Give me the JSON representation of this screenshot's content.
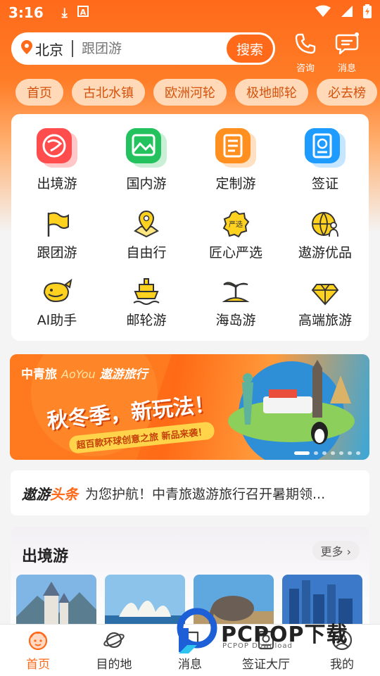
{
  "status_bar": {
    "time": "3:16",
    "icons": [
      "download-icon",
      "font-icon",
      "wifi-icon",
      "signal-icon",
      "battery-icon"
    ]
  },
  "header": {
    "city": "北京",
    "search_placeholder": "跟团游",
    "search_button": "搜索",
    "consult_label": "咨询",
    "message_label": "消息"
  },
  "tags": [
    "首页",
    "古北水镇",
    "欧洲河轮",
    "极地邮轮",
    "必去榜"
  ],
  "categories": [
    {
      "label": "出境游",
      "icon": "globe-plane-icon"
    },
    {
      "label": "国内游",
      "icon": "landscape-photo-icon"
    },
    {
      "label": "定制游",
      "icon": "checklist-icon"
    },
    {
      "label": "签证",
      "icon": "passport-icon"
    },
    {
      "label": "跟团游",
      "icon": "flag-icon"
    },
    {
      "label": "自由行",
      "icon": "map-pin-icon"
    },
    {
      "label": "匠心严选",
      "icon": "quality-seal-icon"
    },
    {
      "label": "遨游优品",
      "icon": "globe-person-icon"
    },
    {
      "label": "AI助手",
      "icon": "whale-icon"
    },
    {
      "label": "邮轮游",
      "icon": "cruise-ship-icon"
    },
    {
      "label": "海岛游",
      "icon": "palm-island-icon"
    },
    {
      "label": "高端旅游",
      "icon": "diamond-icon"
    }
  ],
  "banner": {
    "brand": "中青旅",
    "brand_en": "AoYou",
    "brand_name": "遨游旅行",
    "headline": "秋冬季，新玩法！",
    "subline": "超百款环球创意之旅 新品来袭！",
    "page_count": 7,
    "current_page": 1
  },
  "news": {
    "brand_part1": "遨游",
    "brand_part2": "头条",
    "text": "为您护航！中青旅遨游旅行召开暑期领..."
  },
  "section": {
    "title": "出境游",
    "more_label": "更多 ›"
  },
  "tabbar": [
    {
      "label": "首页",
      "icon": "home-face-icon",
      "active": true
    },
    {
      "label": "目的地",
      "icon": "planet-icon",
      "active": false
    },
    {
      "label": "消息",
      "icon": "message-icon",
      "active": false
    },
    {
      "label": "签证大厅",
      "icon": "visa-icon",
      "active": false
    },
    {
      "label": "我的",
      "icon": "profile-icon",
      "active": false
    }
  ],
  "watermark": {
    "title": "PCPOP下载",
    "subtitle": "PCPOP Download"
  },
  "colors": {
    "brand": "#ff6a1a",
    "tag_bg": "#ffd9b8",
    "tag_text": "#d5520c"
  }
}
